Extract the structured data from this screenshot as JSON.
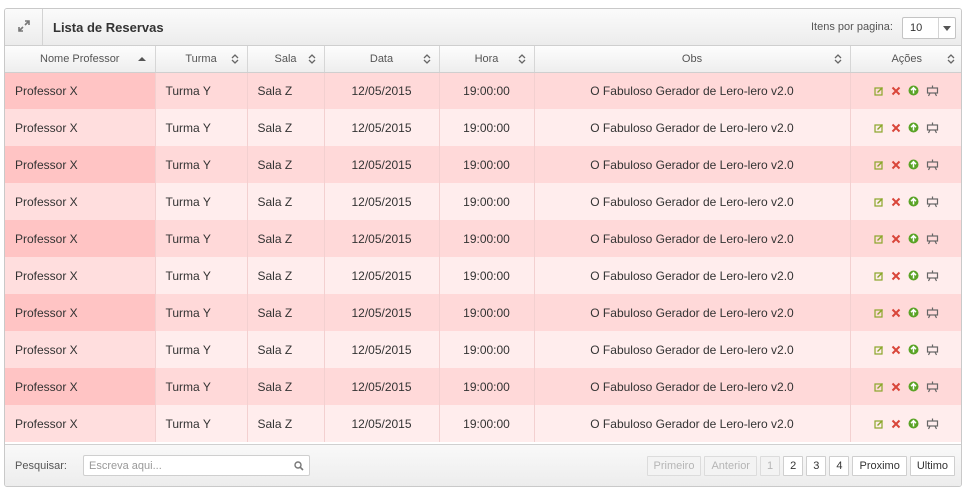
{
  "header": {
    "title": "Lista de Reservas",
    "per_page_label": "Itens por pagina:",
    "per_page_value": "10"
  },
  "columns": [
    {
      "label": "Nome Professor",
      "sort": "asc"
    },
    {
      "label": "Turma",
      "sort": "both"
    },
    {
      "label": "Sala",
      "sort": "both"
    },
    {
      "label": "Data",
      "sort": "both"
    },
    {
      "label": "Hora",
      "sort": "both"
    },
    {
      "label": "Obs",
      "sort": "both"
    },
    {
      "label": "Ações",
      "sort": "both"
    }
  ],
  "rows": [
    {
      "professor": "Professor X",
      "turma": "Turma Y",
      "sala": "Sala Z",
      "data": "12/05/2015",
      "hora": "19:00:00",
      "obs": "O Fabuloso Gerador de Lero-lero v2.0"
    },
    {
      "professor": "Professor X",
      "turma": "Turma Y",
      "sala": "Sala Z",
      "data": "12/05/2015",
      "hora": "19:00:00",
      "obs": "O Fabuloso Gerador de Lero-lero v2.0"
    },
    {
      "professor": "Professor X",
      "turma": "Turma Y",
      "sala": "Sala Z",
      "data": "12/05/2015",
      "hora": "19:00:00",
      "obs": "O Fabuloso Gerador de Lero-lero v2.0"
    },
    {
      "professor": "Professor X",
      "turma": "Turma Y",
      "sala": "Sala Z",
      "data": "12/05/2015",
      "hora": "19:00:00",
      "obs": "O Fabuloso Gerador de Lero-lero v2.0"
    },
    {
      "professor": "Professor X",
      "turma": "Turma Y",
      "sala": "Sala Z",
      "data": "12/05/2015",
      "hora": "19:00:00",
      "obs": "O Fabuloso Gerador de Lero-lero v2.0"
    },
    {
      "professor": "Professor X",
      "turma": "Turma Y",
      "sala": "Sala Z",
      "data": "12/05/2015",
      "hora": "19:00:00",
      "obs": "O Fabuloso Gerador de Lero-lero v2.0"
    },
    {
      "professor": "Professor X",
      "turma": "Turma Y",
      "sala": "Sala Z",
      "data": "12/05/2015",
      "hora": "19:00:00",
      "obs": "O Fabuloso Gerador de Lero-lero v2.0"
    },
    {
      "professor": "Professor X",
      "turma": "Turma Y",
      "sala": "Sala Z",
      "data": "12/05/2015",
      "hora": "19:00:00",
      "obs": "O Fabuloso Gerador de Lero-lero v2.0"
    },
    {
      "professor": "Professor X",
      "turma": "Turma Y",
      "sala": "Sala Z",
      "data": "12/05/2015",
      "hora": "19:00:00",
      "obs": "O Fabuloso Gerador de Lero-lero v2.0"
    },
    {
      "professor": "Professor X",
      "turma": "Turma Y",
      "sala": "Sala Z",
      "data": "12/05/2015",
      "hora": "19:00:00",
      "obs": "O Fabuloso Gerador de Lero-lero v2.0"
    }
  ],
  "row_actions": [
    "edit-icon",
    "delete-icon",
    "upload-icon",
    "projector-icon"
  ],
  "footer": {
    "search_label": "Pesquisar:",
    "search_placeholder": "Escreva aqui...",
    "search_value": "",
    "pagination": [
      {
        "label": "Primeiro",
        "disabled": true,
        "name": "first-page-button"
      },
      {
        "label": "Anterior",
        "disabled": true,
        "name": "previous-page-button"
      },
      {
        "label": "1",
        "disabled": true,
        "name": "page-1-button"
      },
      {
        "label": "2",
        "disabled": false,
        "name": "page-2-button"
      },
      {
        "label": "3",
        "disabled": false,
        "name": "page-3-button"
      },
      {
        "label": "4",
        "disabled": false,
        "name": "page-4-button"
      },
      {
        "label": "Proximo",
        "disabled": false,
        "name": "next-page-button"
      },
      {
        "label": "Ultimo",
        "disabled": false,
        "name": "last-page-button"
      }
    ]
  },
  "colors": {
    "row_odd": "#ffd9d9",
    "row_even": "#ffeded",
    "edit": "#8aa72a",
    "delete": "#d9463a",
    "upload": "#5aa326",
    "projector": "#666666"
  }
}
